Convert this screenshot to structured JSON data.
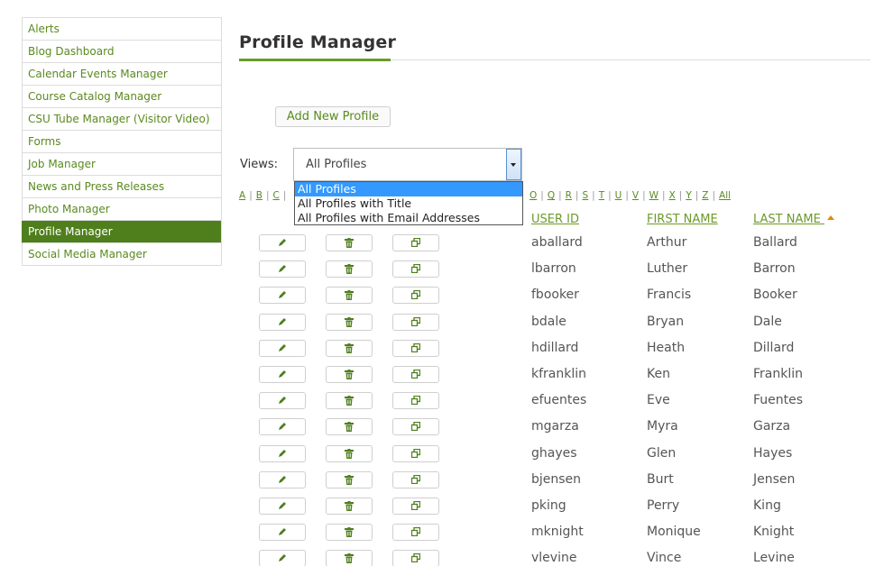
{
  "sidebar": {
    "items": [
      {
        "label": "Alerts",
        "active": false
      },
      {
        "label": "Blog Dashboard",
        "active": false
      },
      {
        "label": "Calendar Events Manager",
        "active": false
      },
      {
        "label": "Course Catalog Manager",
        "active": false
      },
      {
        "label": "CSU Tube Manager (Visitor Video)",
        "active": false
      },
      {
        "label": "Forms",
        "active": false
      },
      {
        "label": "Job Manager",
        "active": false
      },
      {
        "label": "News and Press Releases",
        "active": false
      },
      {
        "label": "Photo Manager",
        "active": false
      },
      {
        "label": "Profile Manager",
        "active": true
      },
      {
        "label": "Social Media Manager",
        "active": false
      }
    ]
  },
  "header": {
    "title": "Profile Manager"
  },
  "toolbar": {
    "add_label": "Add New Profile"
  },
  "views": {
    "label": "Views:",
    "selected": "All Profiles",
    "options": [
      "All Profiles",
      "All Profiles with Title",
      "All Profiles with Email Addresses"
    ]
  },
  "alphabet_left": [
    "A",
    "B",
    "C"
  ],
  "alphabet_right": [
    "O",
    "Q",
    "R",
    "S",
    "T",
    "U",
    "V",
    "W",
    "X",
    "Y",
    "Z",
    "All"
  ],
  "table": {
    "headers": {
      "user_id": "USER ID",
      "first_name": "FIRST NAME",
      "last_name": "LAST NAME"
    },
    "rows": [
      {
        "user_id": "aballard",
        "first": "Arthur",
        "last": "Ballard"
      },
      {
        "user_id": "lbarron",
        "first": "Luther",
        "last": "Barron"
      },
      {
        "user_id": "fbooker",
        "first": "Francis",
        "last": "Booker"
      },
      {
        "user_id": "bdale",
        "first": "Bryan",
        "last": "Dale"
      },
      {
        "user_id": "hdillard",
        "first": "Heath",
        "last": "Dillard"
      },
      {
        "user_id": "kfranklin",
        "first": "Ken",
        "last": "Franklin"
      },
      {
        "user_id": "efuentes",
        "first": "Eve",
        "last": "Fuentes"
      },
      {
        "user_id": "mgarza",
        "first": "Myra",
        "last": "Garza"
      },
      {
        "user_id": "ghayes",
        "first": "Glen",
        "last": "Hayes"
      },
      {
        "user_id": "bjensen",
        "first": "Burt",
        "last": "Jensen"
      },
      {
        "user_id": "pking",
        "first": "Perry",
        "last": "King"
      },
      {
        "user_id": "mknight",
        "first": "Monique",
        "last": "Knight"
      },
      {
        "user_id": "vlevine",
        "first": "Vince",
        "last": "Levine"
      }
    ]
  },
  "icons": {
    "edit": "pencil-icon",
    "delete": "trash-icon",
    "copy": "copy-icon"
  },
  "colors": {
    "accent": "#6b9b2a",
    "active_bg": "#4f7f1d",
    "select_highlight": "#3399ff",
    "sort_arrow": "#e08a00"
  }
}
